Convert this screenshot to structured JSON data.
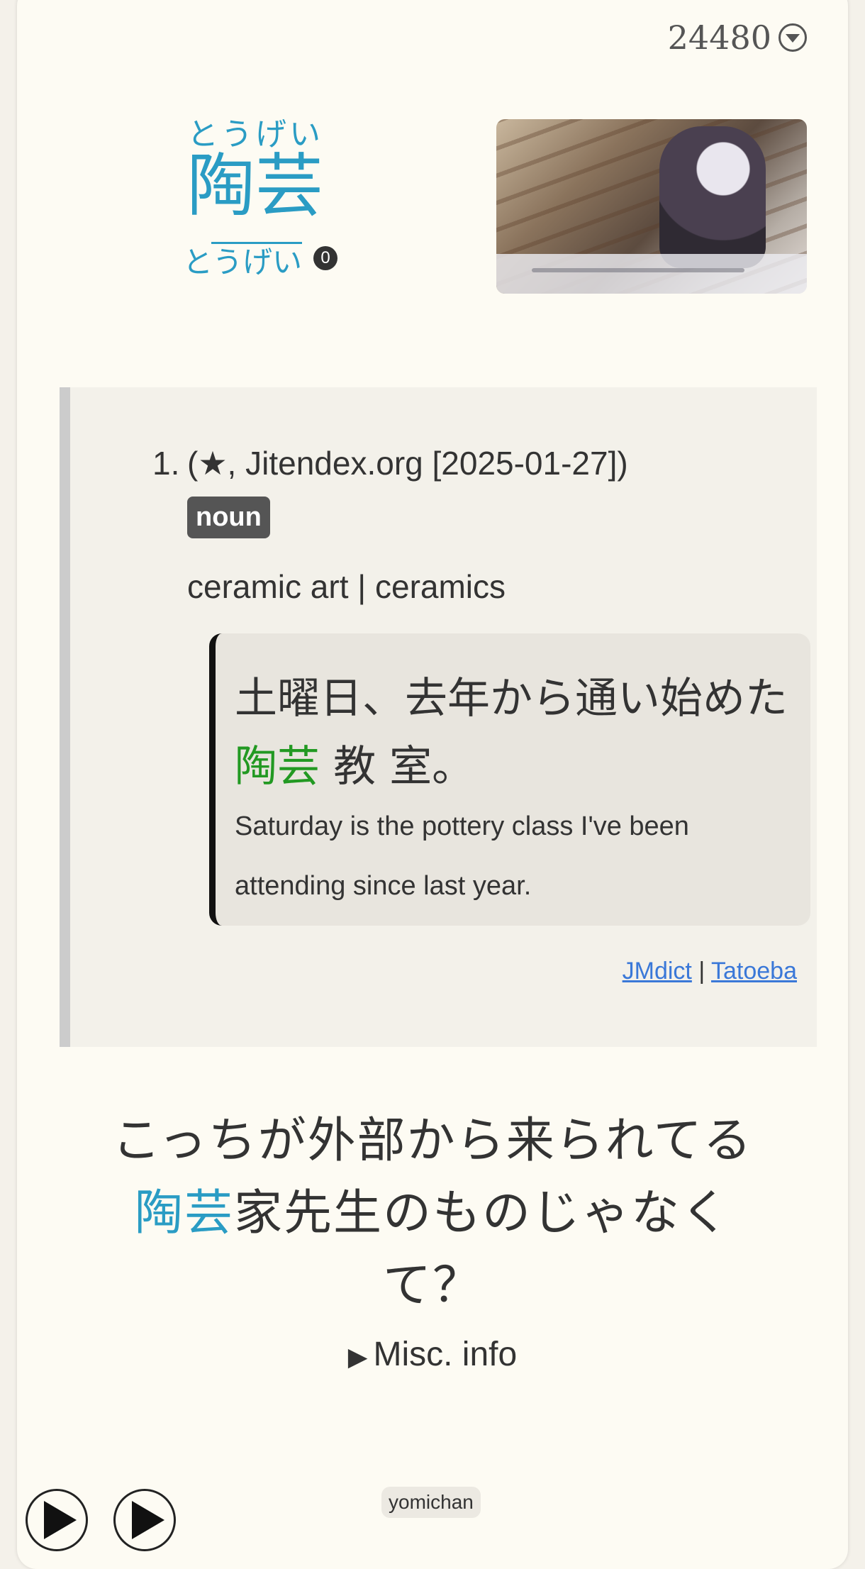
{
  "frequency": {
    "value": "24480",
    "dropdown_icon": "chevron-down-circle-icon"
  },
  "headword": {
    "furigana": "とうげい",
    "kanji": "陶芸"
  },
  "pitch": {
    "reading": "とうげい",
    "badge": "0"
  },
  "definition": {
    "number": "1.",
    "tags": "(★, Jitendex.org [2025-01-27])",
    "part_of_speech": "noun",
    "glossary": "ceramic art | ceramics",
    "example": {
      "jp_before": "土曜日、去年から通い始めた",
      "jp_highlight": "陶芸",
      "jp_after": " 教 室。",
      "en": "Saturday is the pottery class I've been attending since last year."
    },
    "source": {
      "link1": "JMdict",
      "sep": " | ",
      "link2": "Tatoeba"
    }
  },
  "sentence": {
    "before": "こっちが外部から来られてる",
    "target": "陶芸",
    "after": "家先生のものじゃなくて？"
  },
  "misc": {
    "triangle": "▶",
    "label": "Misc. info"
  },
  "tag": "yomichan",
  "controls": {
    "play_icon": "play-icon"
  },
  "colors": {
    "accent": "#2a9cc4",
    "highlight": "#229922",
    "link": "#3a78d8"
  }
}
